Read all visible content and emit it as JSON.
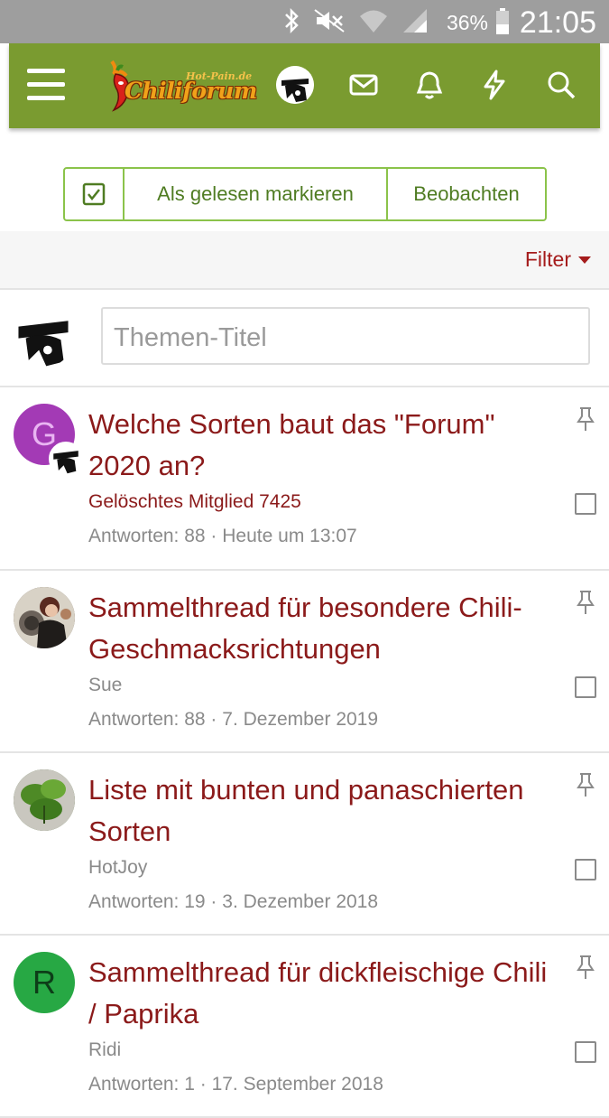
{
  "status_bar": {
    "battery": "36%",
    "time": "21:05"
  },
  "header": {
    "logo_text": "Chiliforum",
    "logo_sub": "Hot-Pain.de",
    "avatar_label": "HARP"
  },
  "actions": {
    "mark_read": "Als gelesen markieren",
    "watch": "Beobachten"
  },
  "filter": {
    "label": "Filter"
  },
  "new_thread": {
    "placeholder": "Themen-Titel"
  },
  "colors": {
    "header_green": "#7a9b30",
    "link_red": "#8b1a1a",
    "button_green": "#4f7c22"
  },
  "threads": [
    {
      "avatar_letter": "G",
      "avatar_color": "#a33ab5",
      "title": "Welche Sorten baut das \"Forum\" 2020 an?",
      "author": "Gelöschtes Mitglied 7425",
      "replies": "Antworten: 88",
      "date": "Heute um 13:07",
      "pinned": true
    },
    {
      "avatar_icon": "photo-avatar-sue",
      "title": "Sammelthread für besondere Chili-Geschmacksrichtungen",
      "author": "Sue",
      "replies": "Antworten: 88",
      "date": "7. Dezember 2019",
      "pinned": true
    },
    {
      "avatar_icon": "photo-avatar-plant",
      "title": "Liste mit bunten und panaschierten Sorten",
      "author": "HotJoy",
      "replies": "Antworten: 19",
      "date": "3. Dezember 2018",
      "pinned": true
    },
    {
      "avatar_letter": "R",
      "avatar_color": "#27a844",
      "title": "Sammelthread für dickfleischige Chili / Paprika",
      "author": "Ridi",
      "replies": "Antworten: 1",
      "date": "17. September 2018",
      "pinned": true
    }
  ]
}
